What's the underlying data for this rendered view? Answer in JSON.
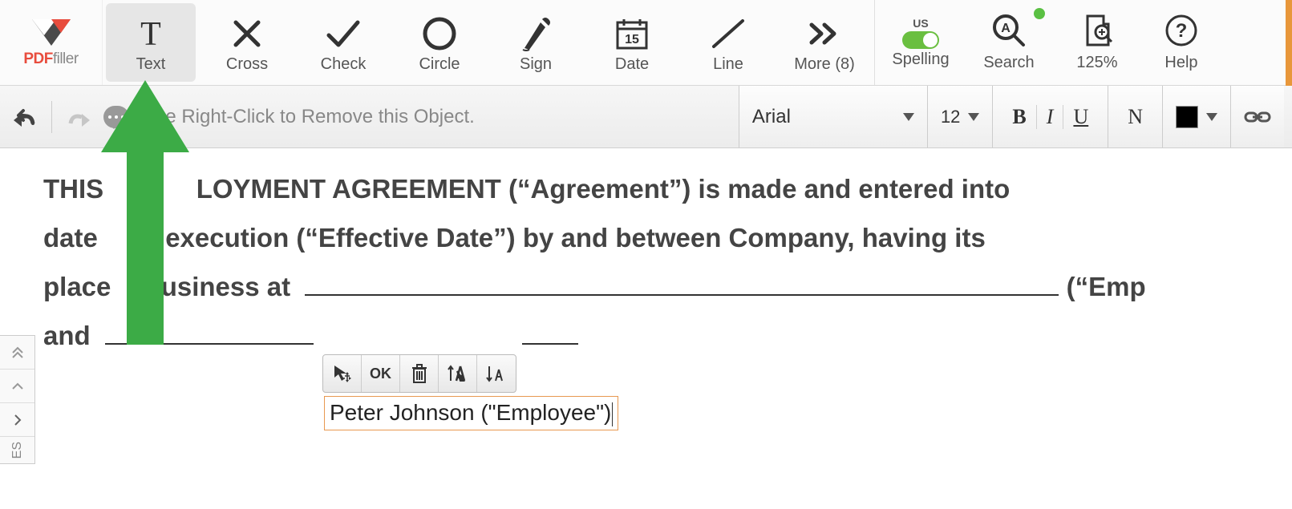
{
  "logo": {
    "part1": "PDF",
    "part2": "filler"
  },
  "tools": {
    "text": "Text",
    "cross": "Cross",
    "check": "Check",
    "circle": "Circle",
    "sign": "Sign",
    "date": "Date",
    "line": "Line",
    "more": "More (8)"
  },
  "right_tools": {
    "spelling": "Spelling",
    "spelling_lang": "US",
    "search": "Search",
    "zoom": "125%",
    "help": "Help"
  },
  "sub": {
    "hint": "Use Right-Click to Remove this Object.",
    "font": "Arial",
    "size": "12",
    "bold": "B",
    "italic": "I",
    "underline": "U",
    "normal": "N"
  },
  "doc": {
    "line1_a": "THIS",
    "line1_b": "LOYMENT AGREEMENT (“Agreement”) is made and entered into",
    "line2_a": "date",
    "line2_b": "execution (“Effective Date”) by and between Company, having its",
    "line3_a": "place",
    "line3_b": "business at",
    "line3_c": "(“Emp",
    "line4": "and"
  },
  "edit": {
    "ok": "OK",
    "value": "Peter Johnson (\"Employee\")"
  },
  "pages": {
    "label": "ES"
  },
  "date_icon_num": "15"
}
